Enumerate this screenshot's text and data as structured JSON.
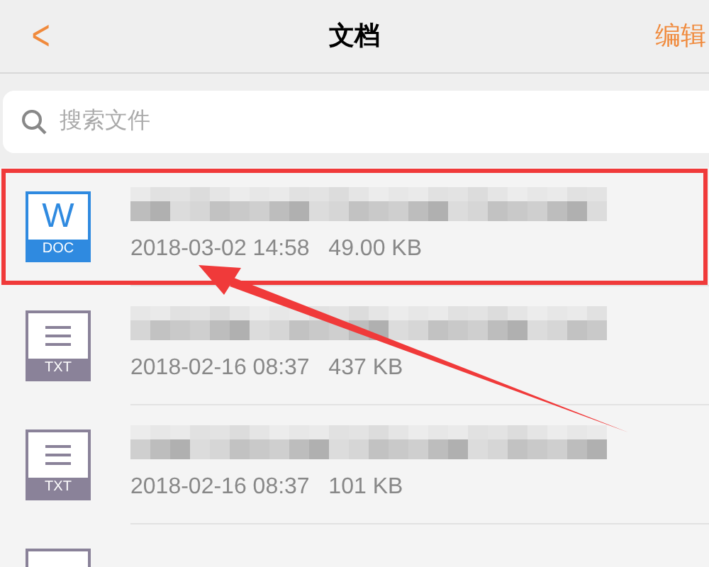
{
  "header": {
    "back": "<",
    "title": "文档",
    "action": "编辑"
  },
  "search": {
    "placeholder": "搜索文件"
  },
  "files": [
    {
      "kind": "doc",
      "glyph": "W",
      "badge": "DOC",
      "date": "2018-03-02 14:58",
      "size": "49.00 KB",
      "highlighted": true
    },
    {
      "kind": "txt",
      "badge": "TXT",
      "date": "2018-02-16 08:37",
      "size": "437 KB",
      "highlighted": false
    },
    {
      "kind": "txt",
      "badge": "TXT",
      "date": "2018-02-16 08:37",
      "size": "101 KB",
      "highlighted": false
    },
    {
      "kind": "txt",
      "highlighted": false
    }
  ]
}
